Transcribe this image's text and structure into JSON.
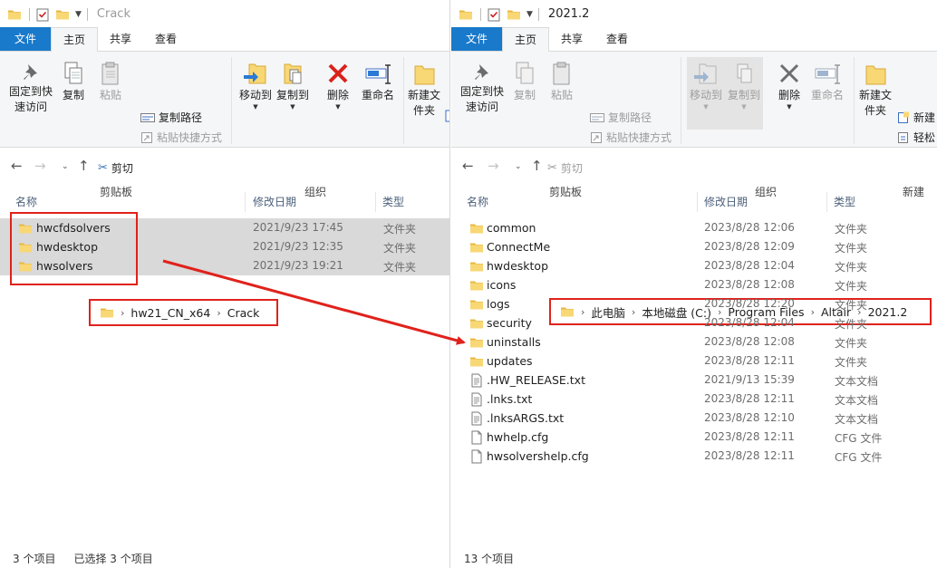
{
  "left": {
    "title": "Crack",
    "menu": {
      "file": "文件",
      "home": "主页",
      "share": "共享",
      "view": "查看"
    },
    "ribbon": {
      "pin": "固定到快速访问",
      "copy": "复制",
      "paste": "粘贴",
      "copy_path": "复制路径",
      "paste_shortcut": "粘贴快捷方式",
      "cut": "剪切",
      "move_to": "移动到",
      "copy_to": "复制到",
      "delete": "删除",
      "rename": "重命名",
      "new_folder": "新建文件夹",
      "group_clipboard": "剪贴板",
      "group_organize": "组织"
    },
    "breadcrumb": [
      "hw21_CN_x64",
      "Crack"
    ],
    "columns": {
      "name": "名称",
      "date": "修改日期",
      "type": "类型"
    },
    "rows": [
      {
        "name": "hwcfdsolvers",
        "date": "2021/9/23 17:45",
        "type": "文件夹"
      },
      {
        "name": "hwdesktop",
        "date": "2021/9/23 12:35",
        "type": "文件夹"
      },
      {
        "name": "hwsolvers",
        "date": "2021/9/23 19:21",
        "type": "文件夹"
      }
    ],
    "status_count": "3 个项目",
    "status_selected": "已选择 3 个项目"
  },
  "right": {
    "title": "2021.2",
    "menu": {
      "file": "文件",
      "home": "主页",
      "share": "共享",
      "view": "查看"
    },
    "ribbon": {
      "pin": "固定到快速访问",
      "copy": "复制",
      "paste": "粘贴",
      "copy_path": "复制路径",
      "paste_shortcut": "粘贴快捷方式",
      "cut": "剪切",
      "move_to": "移动到",
      "copy_to": "复制到",
      "delete": "删除",
      "rename": "重命名",
      "new_folder": "新建文件夹",
      "new_item": "新建",
      "easy_access": "轻松",
      "group_clipboard": "剪贴板",
      "group_organize": "组织",
      "group_new": "新建"
    },
    "breadcrumb": [
      "此电脑",
      "本地磁盘 (C:)",
      "Program Files",
      "Altair",
      "2021.2"
    ],
    "columns": {
      "name": "名称",
      "date": "修改日期",
      "type": "类型"
    },
    "rows": [
      {
        "name": "common",
        "date": "2023/8/28 12:06",
        "type": "文件夹",
        "icon": "folder-icon"
      },
      {
        "name": "ConnectMe",
        "date": "2023/8/28 12:09",
        "type": "文件夹",
        "icon": "folder-icon"
      },
      {
        "name": "hwdesktop",
        "date": "2023/8/28 12:04",
        "type": "文件夹",
        "icon": "folder-icon"
      },
      {
        "name": "icons",
        "date": "2023/8/28 12:08",
        "type": "文件夹",
        "icon": "folder-icon"
      },
      {
        "name": "logs",
        "date": "2023/8/28 12:20",
        "type": "文件夹",
        "icon": "folder-icon"
      },
      {
        "name": "security",
        "date": "2023/8/28 12:04",
        "type": "文件夹",
        "icon": "folder-icon"
      },
      {
        "name": "uninstalls",
        "date": "2023/8/28 12:08",
        "type": "文件夹",
        "icon": "folder-icon"
      },
      {
        "name": "updates",
        "date": "2023/8/28 12:11",
        "type": "文件夹",
        "icon": "folder-icon"
      },
      {
        "name": ".HW_RELEASE.txt",
        "date": "2021/9/13 15:39",
        "type": "文本文档",
        "icon": "text-file-icon"
      },
      {
        "name": ".lnks.txt",
        "date": "2023/8/28 12:11",
        "type": "文本文档",
        "icon": "text-file-icon"
      },
      {
        "name": ".lnksARGS.txt",
        "date": "2023/8/28 12:10",
        "type": "文本文档",
        "icon": "text-file-icon"
      },
      {
        "name": "hwhelp.cfg",
        "date": "2023/8/28 12:11",
        "type": "CFG 文件",
        "icon": "file-icon"
      },
      {
        "name": "hwsolvershelp.cfg",
        "date": "2023/8/28 12:11",
        "type": "CFG 文件",
        "icon": "file-icon"
      }
    ],
    "status_count": "13 个项目"
  },
  "colors": {
    "accent": "#1979ca",
    "annotation_red": "#e0221c",
    "selection": "#d9d9d9",
    "folder": "#f8d775"
  }
}
